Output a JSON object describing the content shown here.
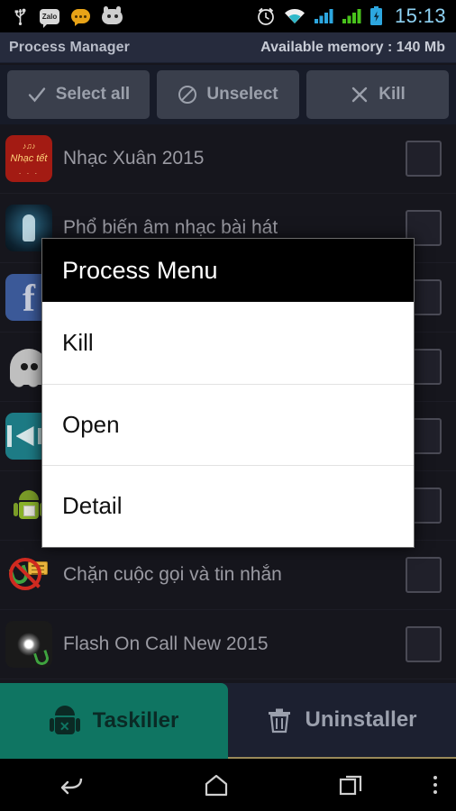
{
  "status_bar": {
    "time": "15:13",
    "left_icons": [
      {
        "name": "usb-icon",
        "label": ""
      },
      {
        "name": "zalo-icon",
        "label": "Zalo"
      },
      {
        "name": "message-icon",
        "label": ""
      },
      {
        "name": "robot-face-icon",
        "label": ""
      }
    ],
    "right_icons": [
      {
        "name": "alarm-icon"
      },
      {
        "name": "wifi-icon"
      },
      {
        "name": "signal-sim1-icon"
      },
      {
        "name": "signal-sim2-icon"
      },
      {
        "name": "battery-charging-icon"
      }
    ]
  },
  "header": {
    "title": "Process Manager",
    "memory": "Available memory : 140 Mb"
  },
  "toolbar": {
    "buttons": [
      {
        "label": "Select all",
        "icon": "check-icon"
      },
      {
        "label": "Unselect",
        "icon": "ban-icon"
      },
      {
        "label": "Kill",
        "icon": "close-icon"
      }
    ]
  },
  "process_list": [
    {
      "label": "Nhạc Xuân 2015",
      "icon": "nhac-xuan-icon",
      "checked": false
    },
    {
      "label": "Phổ biến âm nhạc bài hát",
      "icon": "pho-bien-icon",
      "checked": false
    },
    {
      "label": "Facebook",
      "icon": "facebook-icon",
      "checked": false
    },
    {
      "label": "",
      "icon": "ghost-icon",
      "checked": false
    },
    {
      "label": "",
      "icon": "camera-icon",
      "checked": false
    },
    {
      "label": "",
      "icon": "android-package-icon",
      "checked": false
    },
    {
      "label": "Chặn cuộc gọi và tin nhắn",
      "icon": "call-block-icon",
      "checked": false
    },
    {
      "label": "Flash On Call New 2015",
      "icon": "flash-call-icon",
      "checked": false
    }
  ],
  "dialog": {
    "title": "Process Menu",
    "items": [
      {
        "label": "Kill"
      },
      {
        "label": "Open"
      },
      {
        "label": "Detail"
      }
    ]
  },
  "tabs": [
    {
      "label": "Taskiller",
      "icon": "android-kill-icon",
      "active": true
    },
    {
      "label": "Uninstaller",
      "icon": "trash-icon",
      "active": false
    }
  ],
  "nav_bar": {
    "back": "back-icon",
    "home": "home-icon",
    "recents": "recents-icon",
    "menu": "overflow-menu-icon"
  },
  "colors": {
    "accent_teal": "#0f7562",
    "app_bg": "#16161d",
    "header_bg": "#262b3d",
    "clock": "#8fd3f4"
  }
}
